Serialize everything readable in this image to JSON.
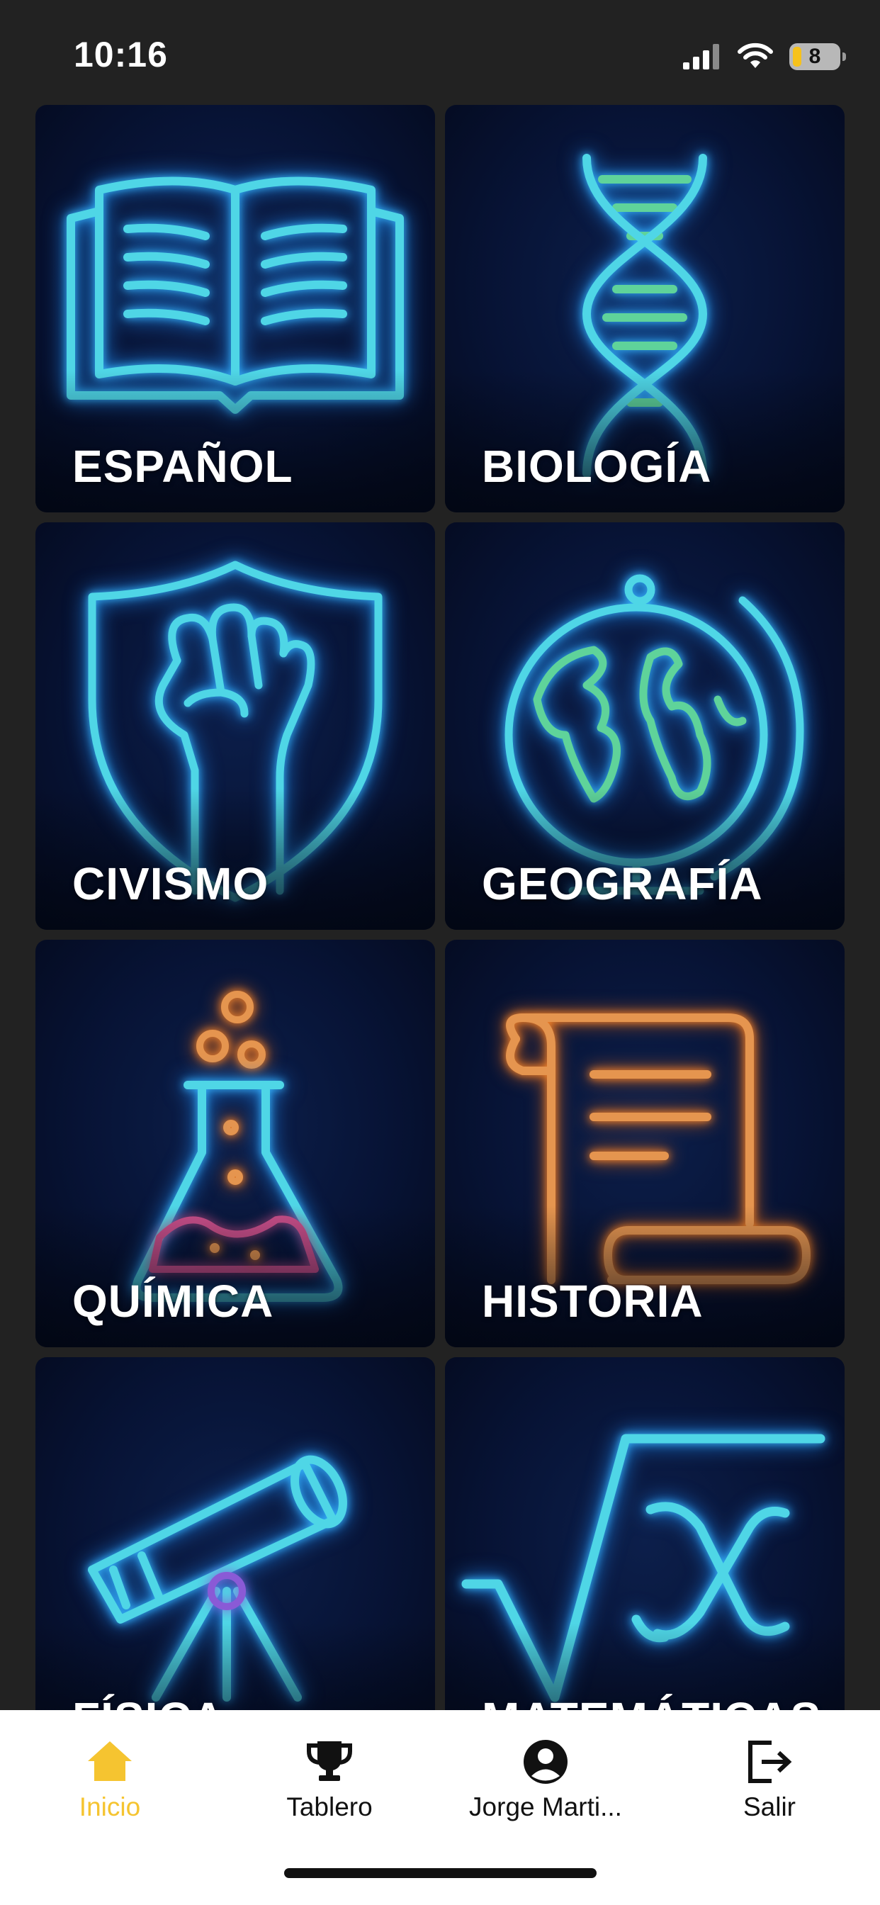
{
  "status_bar": {
    "time": "10:16",
    "battery": "8"
  },
  "subjects": [
    {
      "label": "ESPAÑOL",
      "icon": "open-book-icon"
    },
    {
      "label": "BIOLOGÍA",
      "icon": "dna-icon"
    },
    {
      "label": "CIVISMO",
      "icon": "shield-fist-icon"
    },
    {
      "label": "GEOGRAFÍA",
      "icon": "globe-icon"
    },
    {
      "label": "QUÍMICA",
      "icon": "flask-icon"
    },
    {
      "label": "HISTORIA",
      "icon": "scroll-icon"
    },
    {
      "label": "FÍSICA",
      "icon": "telescope-icon"
    },
    {
      "label": "MATEMÁTICAS",
      "icon": "square-root-icon"
    }
  ],
  "bottom_nav": [
    {
      "label": "Inicio",
      "icon": "home-icon",
      "active": true
    },
    {
      "label": "Tablero",
      "icon": "trophy-icon",
      "active": false
    },
    {
      "label": "Jorge Marti...",
      "icon": "account-icon",
      "active": false
    },
    {
      "label": "Salir",
      "icon": "logout-icon",
      "active": false
    }
  ],
  "colors": {
    "background": "#222222",
    "tile_background": "#071335",
    "neon_cyan": "#4fd6e6",
    "neon_green": "#5fd39a",
    "neon_orange": "#e5954f",
    "neon_pink": "#c94f8a",
    "active_nav": "#f5c430"
  }
}
